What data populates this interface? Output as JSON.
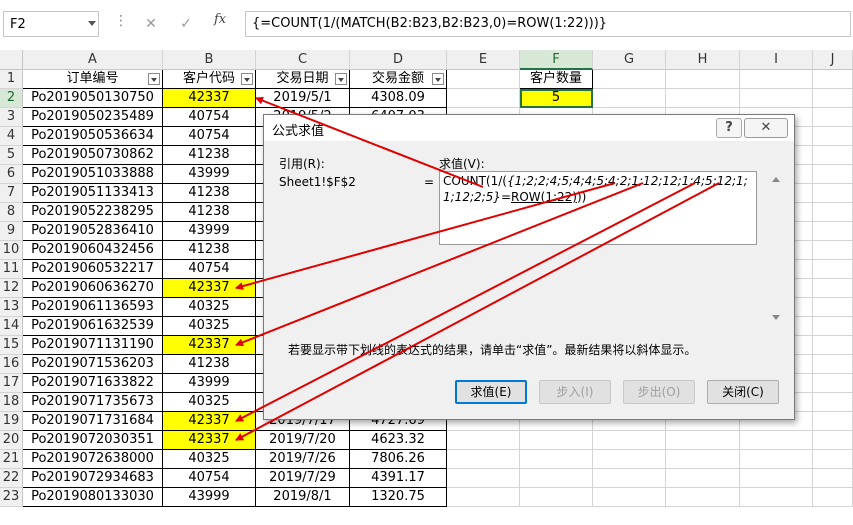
{
  "formula_bar": {
    "name_box": "F2",
    "cancel_icon": "✕",
    "enter_icon": "✓",
    "fx_label": "fx",
    "formula": "{=COUNT(1/(MATCH(B2:B23,B2:B23,0)=ROW(1:22)))}"
  },
  "columns": [
    "A",
    "B",
    "C",
    "D",
    "E",
    "F",
    "G",
    "H",
    "I",
    "J"
  ],
  "header": {
    "order_no": "订单编号",
    "customer_code": "客户代码",
    "trade_date": "交易日期",
    "amount": "交易金额",
    "customer_count": "客户数量"
  },
  "rows": [
    {
      "num": "2",
      "order": "Po2019050130750",
      "code": "42337",
      "date": "2019/5/1",
      "amount": "4308.09",
      "hl": true
    },
    {
      "num": "3",
      "order": "Po2019050235489",
      "code": "40754",
      "date": "2019/5/2",
      "amount": "6407.03",
      "hl": false
    },
    {
      "num": "4",
      "order": "Po2019050536634",
      "code": "40754",
      "date": "",
      "amount": "",
      "hl": false
    },
    {
      "num": "5",
      "order": "Po2019050730862",
      "code": "41238",
      "date": "",
      "amount": "",
      "hl": false
    },
    {
      "num": "6",
      "order": "Po2019051033888",
      "code": "43999",
      "date": "",
      "amount": "",
      "hl": false
    },
    {
      "num": "7",
      "order": "Po2019051133413",
      "code": "41238",
      "date": "",
      "amount": "",
      "hl": false
    },
    {
      "num": "8",
      "order": "Po2019052238295",
      "code": "41238",
      "date": "",
      "amount": "",
      "hl": false
    },
    {
      "num": "9",
      "order": "Po2019052836410",
      "code": "43999",
      "date": "",
      "amount": "",
      "hl": false
    },
    {
      "num": "10",
      "order": "Po2019060432456",
      "code": "41238",
      "date": "",
      "amount": "",
      "hl": false
    },
    {
      "num": "11",
      "order": "Po2019060532217",
      "code": "40754",
      "date": "",
      "amount": "",
      "hl": false
    },
    {
      "num": "12",
      "order": "Po2019060636270",
      "code": "42337",
      "date": "",
      "amount": "",
      "hl": true
    },
    {
      "num": "13",
      "order": "Po2019061136593",
      "code": "40325",
      "date": "",
      "amount": "",
      "hl": false
    },
    {
      "num": "14",
      "order": "Po2019061632539",
      "code": "40325",
      "date": "",
      "amount": "",
      "hl": false
    },
    {
      "num": "15",
      "order": "Po2019071131190",
      "code": "42337",
      "date": "",
      "amount": "",
      "hl": true
    },
    {
      "num": "16",
      "order": "Po2019071536203",
      "code": "41238",
      "date": "",
      "amount": "",
      "hl": false
    },
    {
      "num": "17",
      "order": "Po2019071633822",
      "code": "43999",
      "date": "",
      "amount": "",
      "hl": false
    },
    {
      "num": "18",
      "order": "Po2019071735673",
      "code": "40325",
      "date": "",
      "amount": "",
      "hl": false
    },
    {
      "num": "19",
      "order": "Po2019071731684",
      "code": "42337",
      "date": "2019/7/17",
      "amount": "4727.69",
      "hl": true
    },
    {
      "num": "20",
      "order": "Po2019072030351",
      "code": "42337",
      "date": "2019/7/20",
      "amount": "4623.32",
      "hl": true
    },
    {
      "num": "21",
      "order": "Po2019072638000",
      "code": "40325",
      "date": "2019/7/26",
      "amount": "7806.26",
      "hl": false
    },
    {
      "num": "22",
      "order": "Po2019072934683",
      "code": "40754",
      "date": "2019/7/29",
      "amount": "4391.17",
      "hl": false
    },
    {
      "num": "23",
      "order": "Po2019080133030",
      "code": "43999",
      "date": "2019/8/1",
      "amount": "1320.75",
      "hl": false
    }
  ],
  "f2_value": "5",
  "dialog": {
    "title": "公式求值",
    "help": "?",
    "close": "✕",
    "ref_label": "引用(R):",
    "ref_value": "Sheet1!$F$2",
    "eq": "=",
    "eval_label": "求值(V):",
    "eval_prefix": "COUNT(1/(",
    "eval_italic": "{1;2;2;4;5;4;4;5;4;2;1;12;12;1;4;5;12;1;1;12;2;5}",
    "eval_mid": "=",
    "eval_underline": "ROW(1:22)",
    "eval_suffix": "))",
    "hint": "若要显示带下划线的表达式的结果，请单击“求值”。最新结果将以斜体显示。",
    "btn_eval": "求值(E)",
    "btn_step_in": "步入(I)",
    "btn_step_out": "步出(O)",
    "btn_close": "关闭(C)"
  },
  "colors": {
    "highlight": "#ffff00",
    "arrow": "#e00000",
    "excel_green": "#217346",
    "default_button_border": "#0078d7"
  }
}
